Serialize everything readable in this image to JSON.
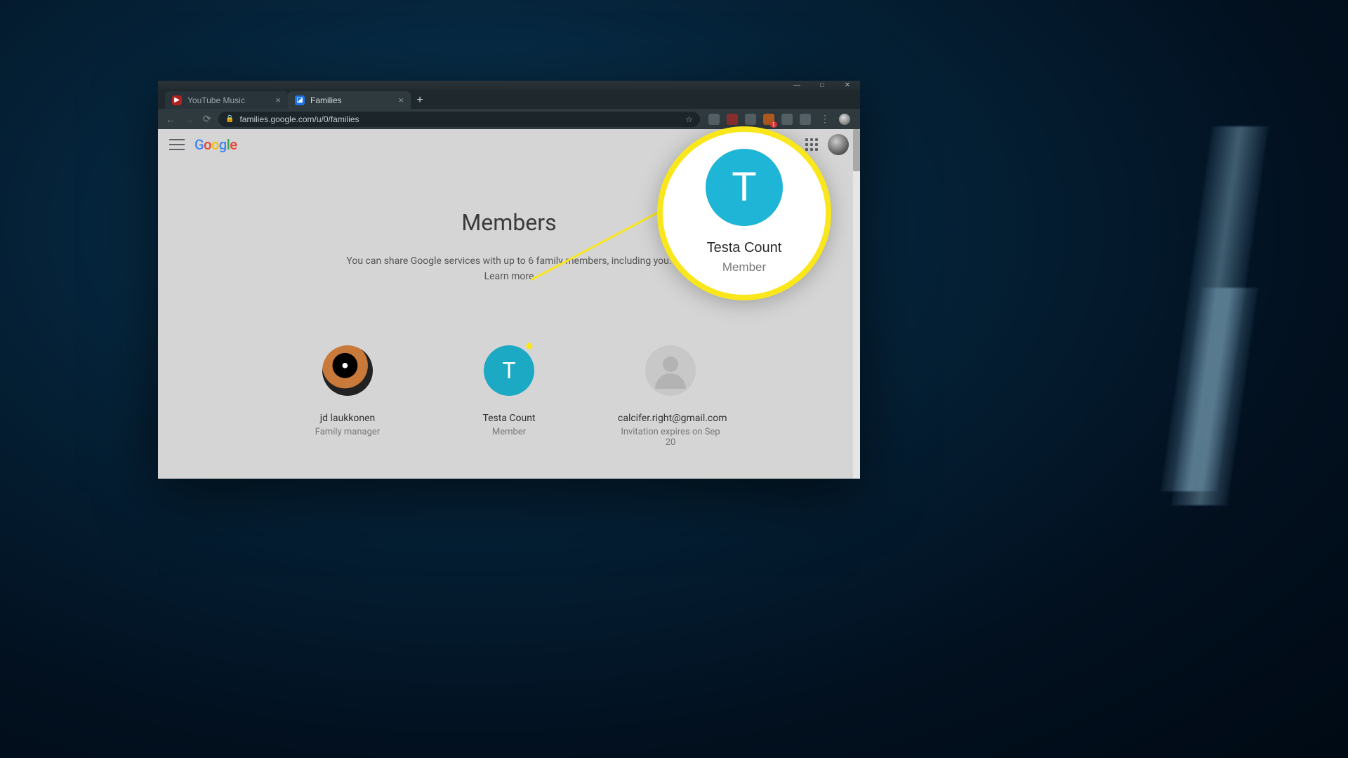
{
  "window": {
    "controls": {
      "min": "—",
      "max": "□",
      "close": "✕"
    }
  },
  "tabs": [
    {
      "label": "YouTube Music",
      "active": false,
      "favicon_bg": "#b02121",
      "favicon_glyph": "▶"
    },
    {
      "label": "Families",
      "active": true,
      "favicon_bg": "#1a73e8",
      "favicon_glyph": "◪"
    }
  ],
  "addressbar": {
    "url": "families.google.com/u/0/families"
  },
  "google_header": {
    "logo_text": "Google"
  },
  "page": {
    "title": "Members",
    "subtitle": "You can share Google services with up to 6 family members, including you.",
    "learn_more": "Learn more"
  },
  "members": [
    {
      "name": "jd laukkonen",
      "role": "Family manager",
      "avatar_type": "photo",
      "initial": ""
    },
    {
      "name": "Testa Count",
      "role": "Member",
      "avatar_type": "teal",
      "initial": "T"
    },
    {
      "name": "calcifer.right@gmail.com",
      "role": "Invitation expires on Sep 20",
      "avatar_type": "ghost",
      "initial": ""
    }
  ],
  "callout": {
    "initial": "T",
    "name": "Testa Count",
    "role": "Member"
  }
}
